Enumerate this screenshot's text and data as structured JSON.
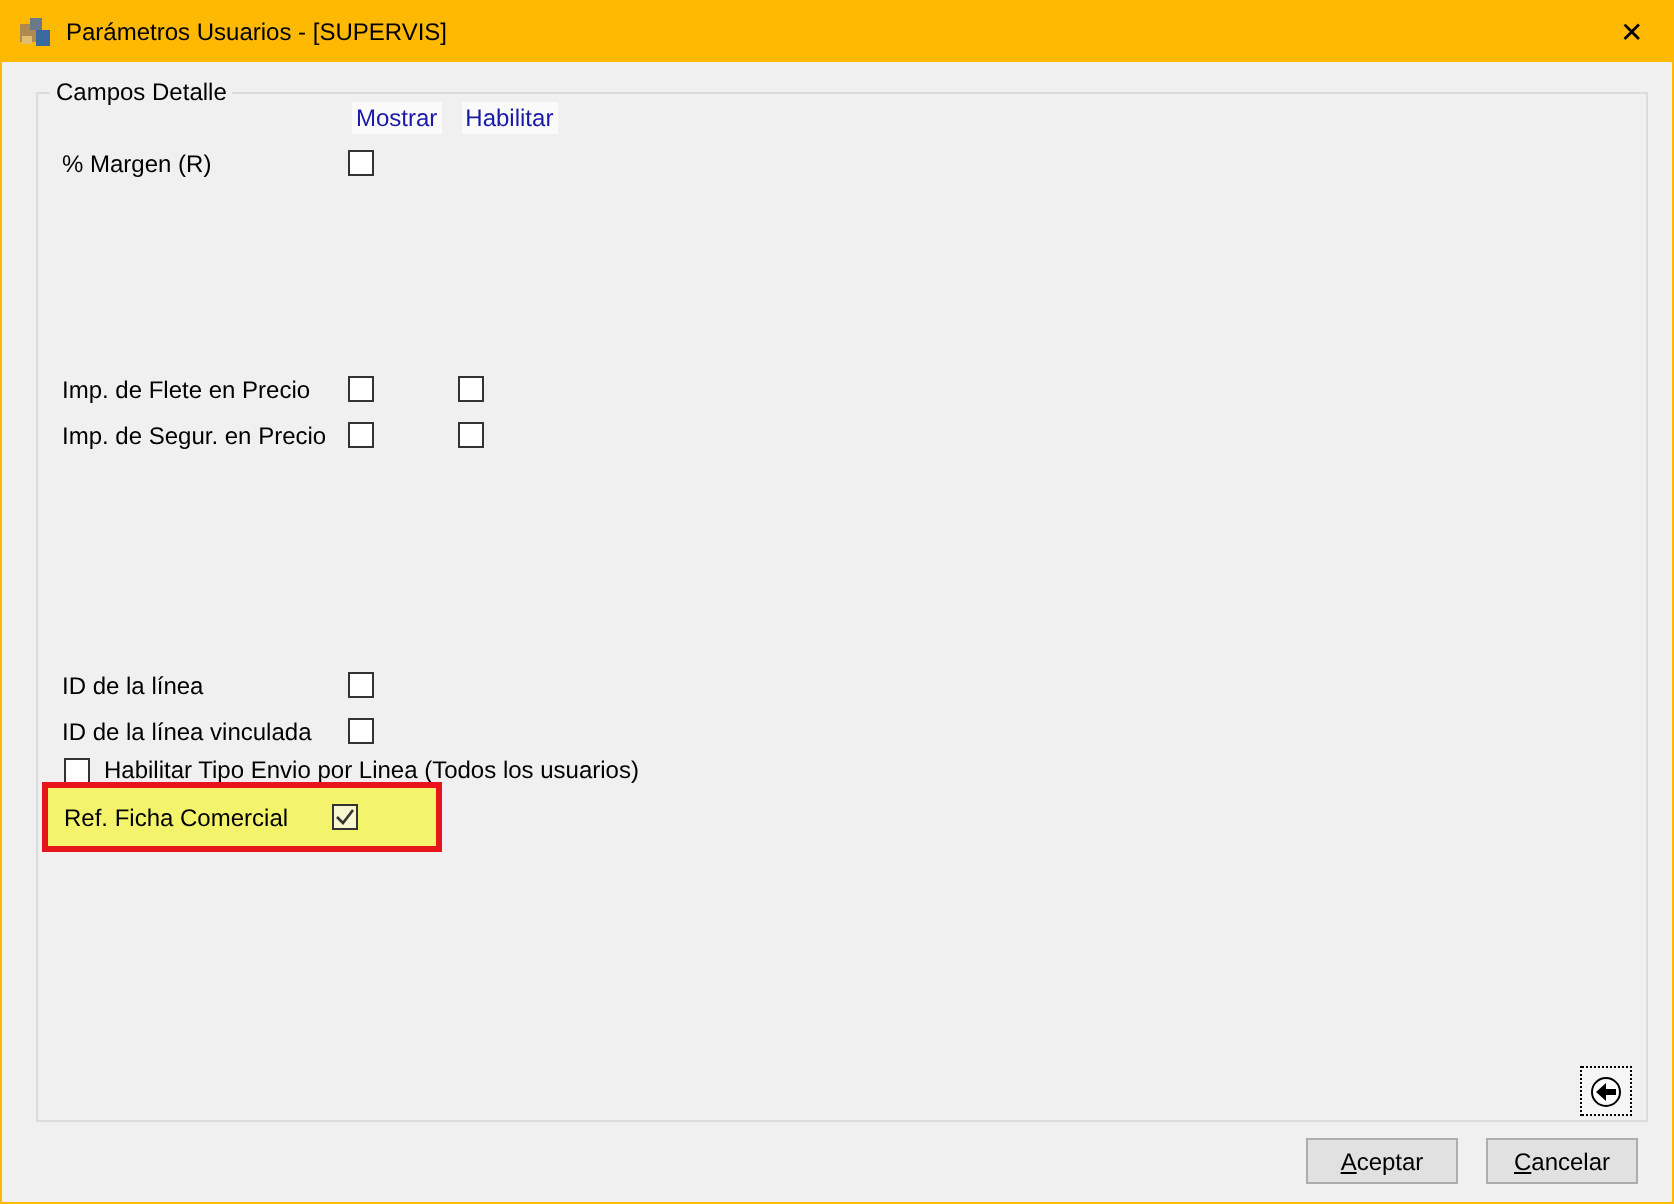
{
  "window": {
    "title": "Parámetros Usuarios - [SUPERVIS]",
    "close": "✕"
  },
  "group": {
    "title": "Campos Detalle",
    "columns": [
      "Mostrar",
      "Habilitar"
    ],
    "rows": [
      {
        "kind": "two",
        "label": "% Margen (R)",
        "show": false
      },
      {
        "kind": "two",
        "label": "Imp. de Flete en Precio",
        "show": false,
        "enable": false
      },
      {
        "kind": "two",
        "label": "Imp. de Segur. en Precio",
        "show": false,
        "enable": false
      },
      {
        "kind": "two",
        "label": "ID de la línea",
        "show": false
      },
      {
        "kind": "two",
        "label": "ID de la línea vinculada",
        "show": false
      },
      {
        "kind": "inline",
        "label": "Habilitar Tipo Envio por Linea (Todos los usuarios)",
        "show": false
      },
      {
        "kind": "two",
        "label": "Ref. Ficha Comercial",
        "show": true,
        "highlighted": true
      }
    ]
  },
  "buttons": [
    "Aceptar",
    "Cancelar"
  ]
}
